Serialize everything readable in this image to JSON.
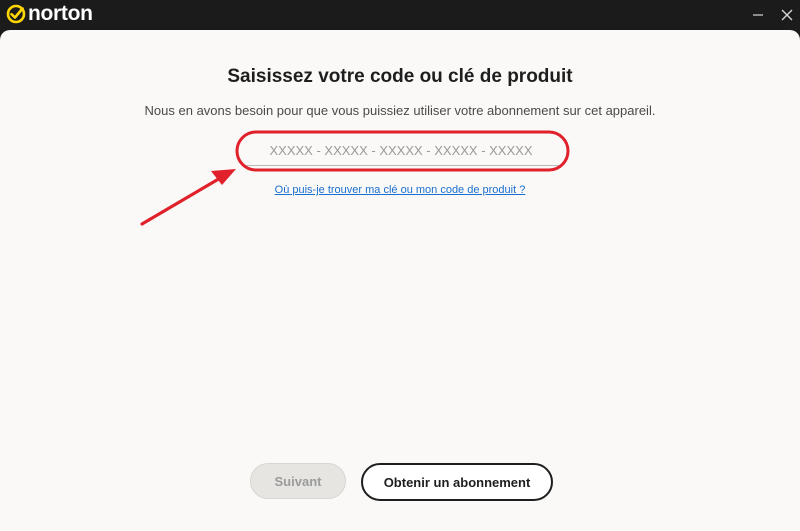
{
  "titlebar": {
    "app_name": "norton",
    "logo_icon": "norton-check-icon",
    "brand_color": "#ffd700",
    "minimize_icon": "minimize-icon",
    "close_icon": "close-icon"
  },
  "main": {
    "title": "Saisissez votre code ou clé de produit",
    "subtitle": "Nous en avons besoin pour que vous puissiez utiliser votre abonnement sur cet appareil.",
    "code_input": {
      "value": "",
      "placeholder": "XXXXX - XXXXX - XXXXX - XXXXX - XXXXX"
    },
    "help_link": "Où puis-je trouver ma clé ou mon code de produit ?",
    "link_color": "#1a6fd0",
    "annotation_color": "#e0202a"
  },
  "footer": {
    "next_label": "Suivant",
    "subscribe_label": "Obtenir un abonnement"
  }
}
